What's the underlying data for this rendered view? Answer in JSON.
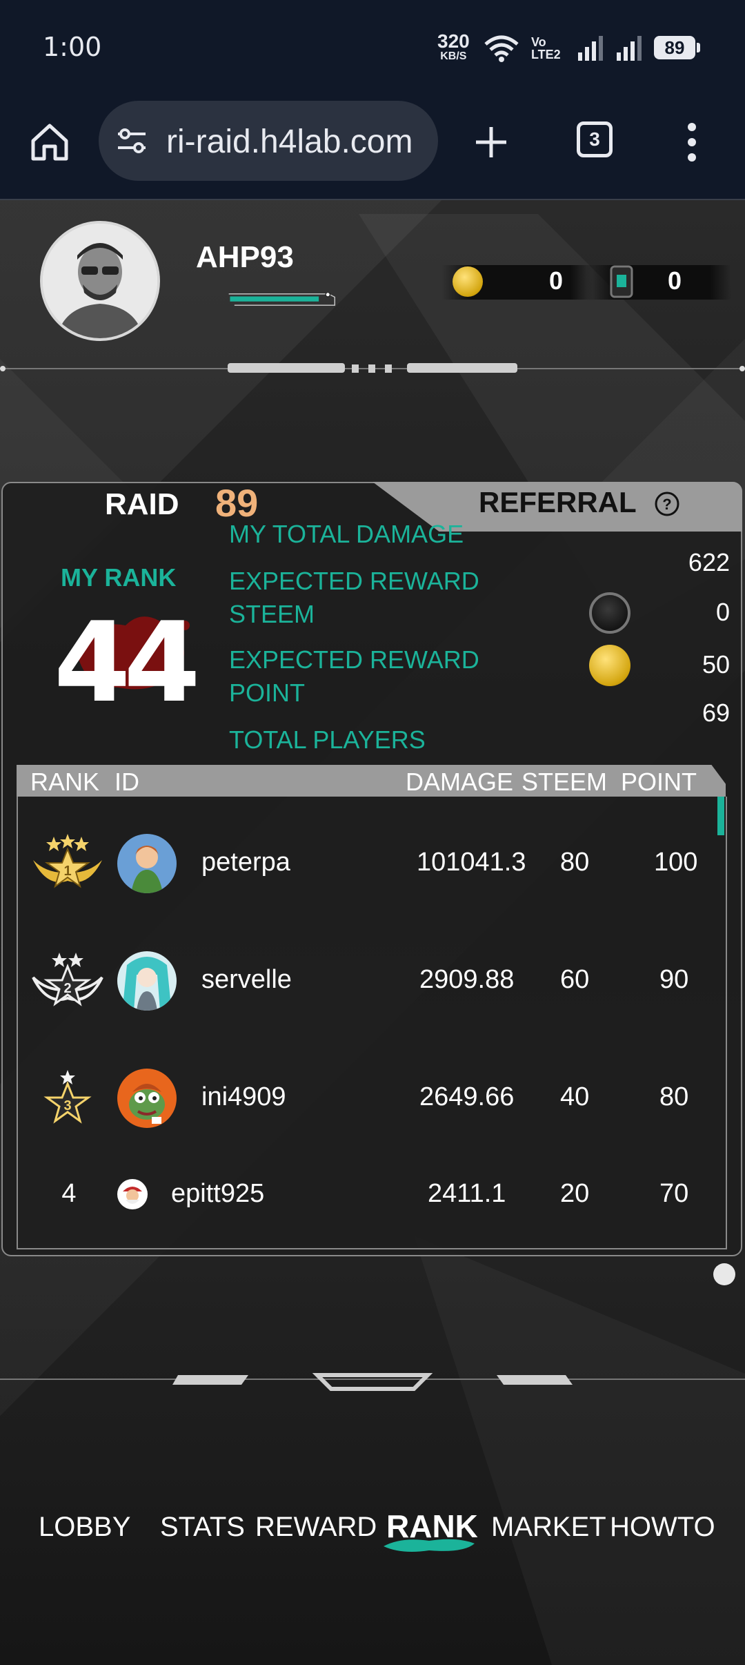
{
  "status_bar": {
    "time": "1:00",
    "net_speed_value": "320",
    "net_speed_unit": "KB/S",
    "volte": "Vo LTE2",
    "battery": "89"
  },
  "browser": {
    "url": "ri-raid.h4lab.com",
    "tab_count": "3"
  },
  "profile": {
    "username": "AHP93",
    "xp_fraction": 0.92,
    "coins": "0",
    "cards": "0"
  },
  "raid_tab": {
    "label": "RAID",
    "raid_number": "89"
  },
  "referral_tab": {
    "label": "REFERRAL"
  },
  "my_rank": {
    "label": "MY RANK",
    "value": "44"
  },
  "stats": {
    "total_damage_label": "MY TOTAL DAMAGE",
    "total_damage_value": "622",
    "reward_steem_label_line1": "EXPECTED REWARD",
    "reward_steem_label_line2": "STEEM",
    "reward_steem_value": "0",
    "reward_point_label_line1": "EXPECTED REWARD",
    "reward_point_label_line2": "POINT",
    "reward_point_value": "50",
    "total_players_label": "TOTAL PLAYERS",
    "total_players_value": "69"
  },
  "table": {
    "headers": {
      "rank": "RANK",
      "id": "ID",
      "damage": "DAMAGE",
      "steem": "STEEM",
      "point": "POINT"
    },
    "rows": [
      {
        "rank": "1",
        "id": "peterpa",
        "damage": "101041.3",
        "steem": "80",
        "point": "100"
      },
      {
        "rank": "2",
        "id": "servelle",
        "damage": "2909.88",
        "steem": "60",
        "point": "90"
      },
      {
        "rank": "3",
        "id": "ini4909",
        "damage": "2649.66",
        "steem": "40",
        "point": "80"
      },
      {
        "rank": "4",
        "id": "epitt925",
        "damage": "2411.1",
        "steem": "20",
        "point": "70"
      }
    ]
  },
  "nav": {
    "lobby": "LOBBY",
    "stats": "STATS",
    "reward": "REWARD",
    "rank": "RANK",
    "market": "MARKET",
    "howto": "HOWTO",
    "active": "RANK"
  },
  "colors": {
    "accent_teal": "#1bb39a",
    "raid_number": "#f0b27a",
    "status_bg": "#101828"
  }
}
